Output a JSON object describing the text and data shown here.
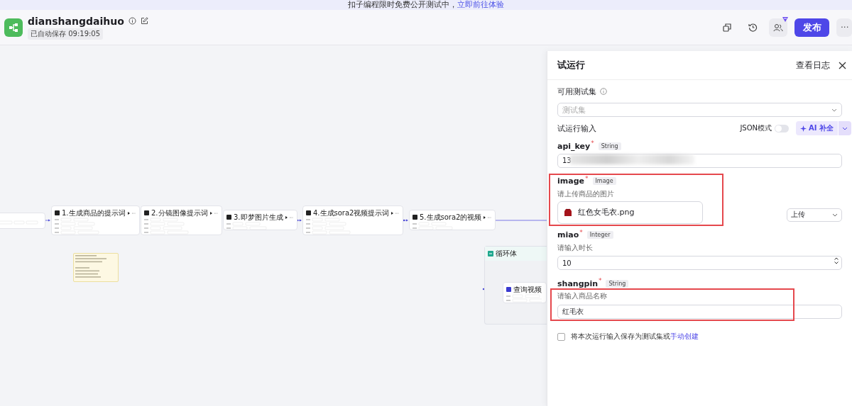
{
  "banner": {
    "text": "扣子编程限时免费公开测试中，",
    "link": "立即前往体验"
  },
  "header": {
    "title": "dianshangdaihuo",
    "autosave": "已自动保存 09:19:05",
    "publish": "发布",
    "more": "···"
  },
  "canvas": {
    "nodes": [
      {
        "title": "1.生成商品的提示词"
      },
      {
        "title": "2.分镜图像提示词"
      },
      {
        "title": "3.即梦图片生成"
      },
      {
        "title": "4.生成sora2视频提示词"
      },
      {
        "title": "5.生成sora2的视频"
      }
    ],
    "loop": {
      "title": "循环体",
      "child": "查询视频"
    }
  },
  "panel": {
    "title": "试运行",
    "log_link": "查看日志",
    "test_set": {
      "label": "可用测试集",
      "placeholder": "测试集"
    },
    "inputs": {
      "label": "试运行输入",
      "json_mode": {
        "label": "JSON模式",
        "on": false
      },
      "ai_button": "AI 补全"
    },
    "params": [
      {
        "kind": "text",
        "name": "api_key",
        "required_mark": "*",
        "type": "String",
        "value": "13",
        "redacted": true
      },
      {
        "kind": "image",
        "name": "image",
        "required_mark": "*",
        "type": "Image",
        "hint": "请上传商品的图片",
        "file": "红色女毛衣.png",
        "upload": "上传",
        "highlighted": true
      },
      {
        "kind": "number",
        "name": "miao",
        "required_mark": "*",
        "type": "Integer",
        "hint": "请输入时长",
        "value": "10"
      },
      {
        "kind": "text",
        "name": "shangpin",
        "required_mark": "*",
        "type": "String",
        "hint": "请输入商品名称",
        "value": "红毛衣",
        "highlighted": true
      }
    ],
    "save_option": {
      "checked": false,
      "text": "将本次运行输入保存为测试集或",
      "link": "手动创建"
    }
  }
}
